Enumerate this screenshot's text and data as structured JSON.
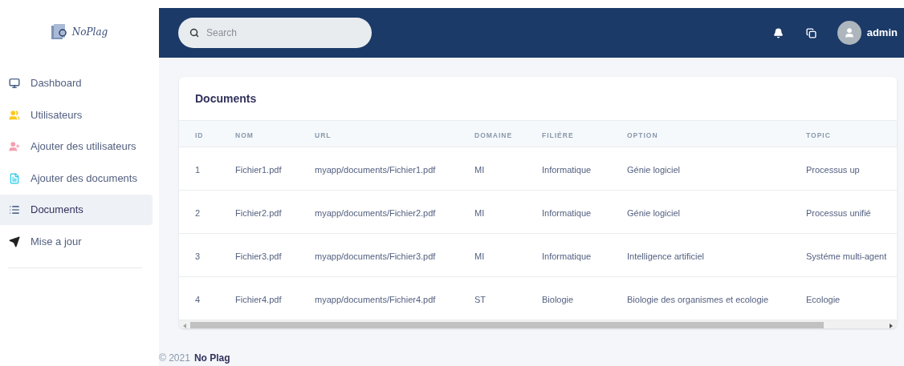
{
  "logo": {
    "text": "NoPlag"
  },
  "sidebar": {
    "items": [
      {
        "label": "Dashboard",
        "selected": false
      },
      {
        "label": "Utilisateurs",
        "selected": false
      },
      {
        "label": "Ajouter des utilisateurs",
        "selected": false
      },
      {
        "label": "Ajouter des documents",
        "selected": false
      },
      {
        "label": "Documents",
        "selected": true
      },
      {
        "label": "Mise a jour",
        "selected": false
      }
    ]
  },
  "header": {
    "search": {
      "placeholder": "Search"
    },
    "user": {
      "name": "admin"
    }
  },
  "card": {
    "title": "Documents",
    "table": {
      "columns": [
        "ID",
        "NOM",
        "URL",
        "DOMAINE",
        "FILIÉRE",
        "OPTION",
        "TOPIC"
      ],
      "rows": [
        [
          "1",
          "Fichier1.pdf",
          "myapp/documents/Fichier1.pdf",
          "MI",
          "Informatique",
          "Génie logiciel",
          "Processus up"
        ],
        [
          "2",
          "Fichier2.pdf",
          "myapp/documents/Fichier2.pdf",
          "MI",
          "Informatique",
          "Génie logiciel",
          "Processus unifié"
        ],
        [
          "3",
          "Fichier3.pdf",
          "myapp/documents/Fichier3.pdf",
          "MI",
          "Informatique",
          "Intelligence artificiel",
          "Systéme multi-agent"
        ],
        [
          "4",
          "Fichier4.pdf",
          "myapp/documents/Fichier4.pdf",
          "ST",
          "Biologie",
          "Biologie des organismes et ecologie",
          "Ecologie"
        ]
      ]
    }
  },
  "footer": {
    "copyright": "© 2021",
    "brand": "No Plag"
  }
}
